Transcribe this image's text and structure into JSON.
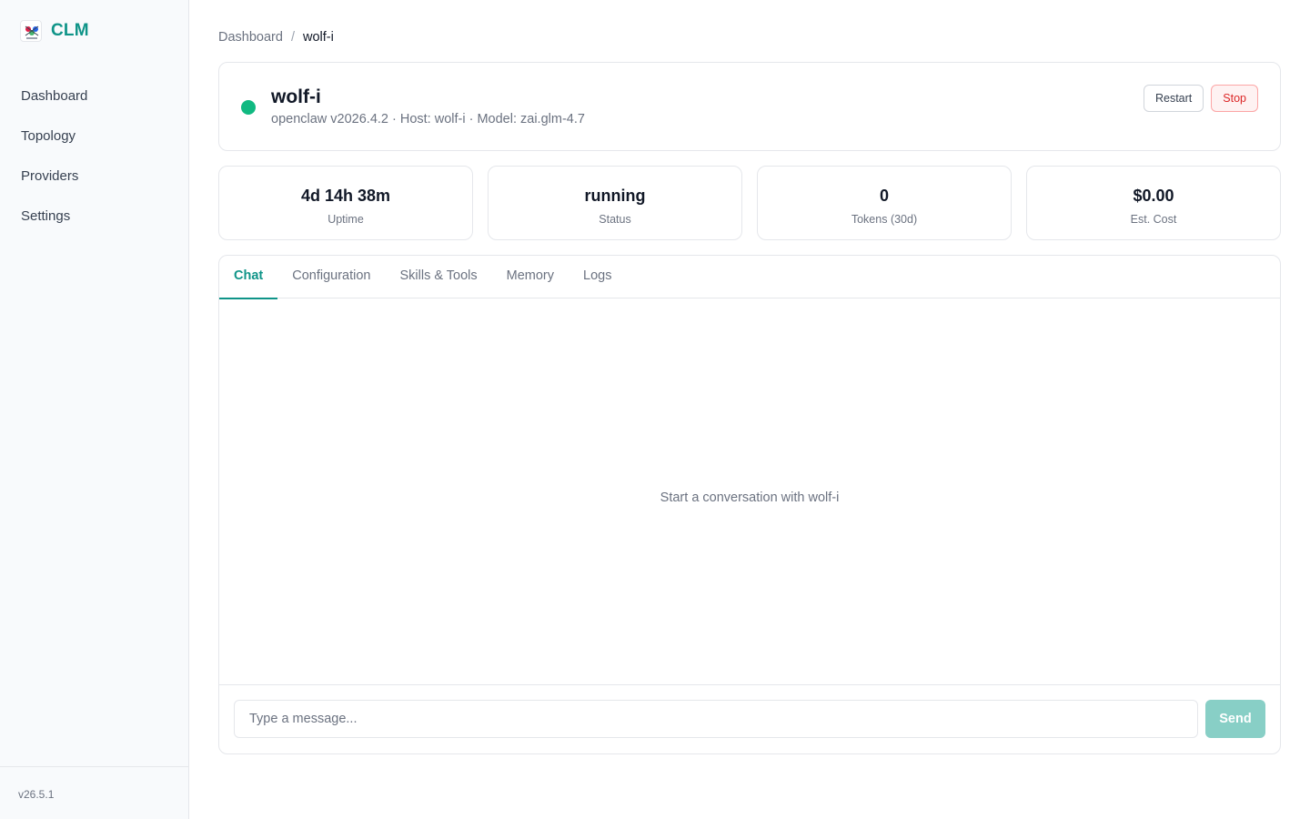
{
  "sidebar": {
    "brand": "CLM",
    "items": [
      {
        "label": "Dashboard"
      },
      {
        "label": "Topology"
      },
      {
        "label": "Providers"
      },
      {
        "label": "Settings"
      }
    ],
    "version": "v26.5.1"
  },
  "breadcrumb": {
    "root": "Dashboard",
    "separator": "/",
    "current": "wolf-i"
  },
  "agent": {
    "name": "wolf-i",
    "meta": "openclaw v2026.4.2 · Host: wolf-i · Model: zai.glm-4.7",
    "status_color": "#10b981",
    "restart_label": "Restart",
    "stop_label": "Stop"
  },
  "stats": [
    {
      "value": "4d 14h 38m",
      "label": "Uptime"
    },
    {
      "value": "running",
      "label": "Status"
    },
    {
      "value": "0",
      "label": "Tokens (30d)"
    },
    {
      "value": "$0.00",
      "label": "Est. Cost"
    }
  ],
  "tabs": [
    {
      "label": "Chat"
    },
    {
      "label": "Configuration"
    },
    {
      "label": "Skills & Tools"
    },
    {
      "label": "Memory"
    },
    {
      "label": "Logs"
    }
  ],
  "chat": {
    "empty_text": "Start a conversation with wolf-i",
    "input_placeholder": "Type a message...",
    "send_label": "Send"
  },
  "colors": {
    "accent": "#0f9488",
    "danger": "#dc2626"
  }
}
